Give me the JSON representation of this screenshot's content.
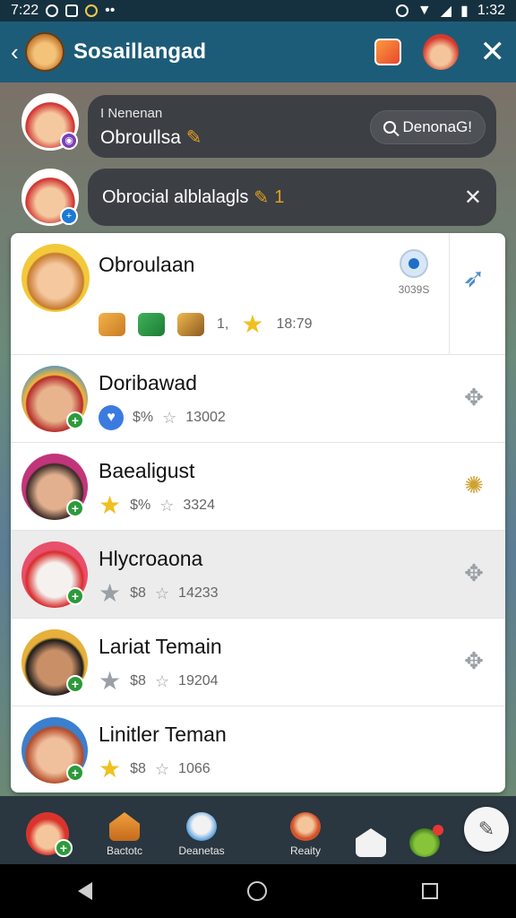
{
  "status_bar": {
    "time": "7:22",
    "time_right": "1:32",
    "dots": "••"
  },
  "app_bar": {
    "title": "Sosaillangad"
  },
  "top": {
    "notice_small": "I Nenenan",
    "notice_big": "Obroullsa",
    "search_chip": "DenonaG!",
    "invite_text": "Obrocial alblalagls",
    "invite_count": "1"
  },
  "friends": [
    {
      "name": "Obroulaan",
      "status_code": "3039S",
      "points": "1,",
      "score": "18:79"
    },
    {
      "name": "Doribawad",
      "prefix": "$%",
      "score": "13002"
    },
    {
      "name": "Baealigust",
      "prefix": "$%",
      "score": "3324"
    },
    {
      "name": "Hlycroaona",
      "prefix": "$8",
      "score": "14233"
    },
    {
      "name": "Lariat Temain",
      "prefix": "$8",
      "score": "19204"
    },
    {
      "name": "Linitler Teman",
      "prefix": "$8",
      "score": "1066"
    }
  ],
  "bottom_nav": [
    {
      "label": ""
    },
    {
      "label": "Bactotc"
    },
    {
      "label": "Deanetas"
    },
    {
      "label": "Reaity"
    },
    {
      "label": ""
    },
    {
      "label": ""
    }
  ]
}
